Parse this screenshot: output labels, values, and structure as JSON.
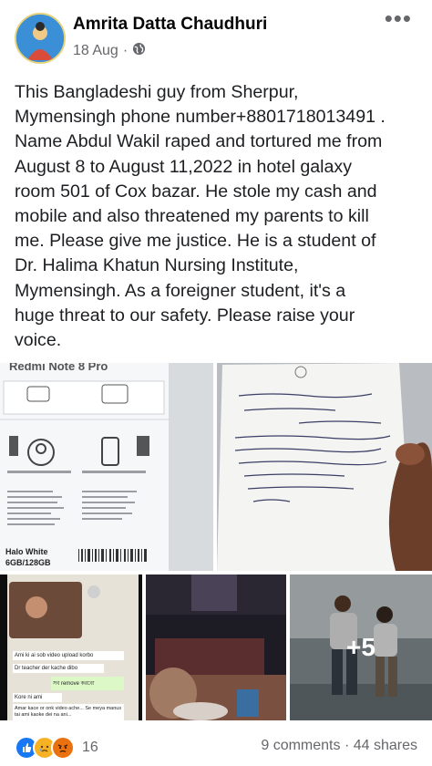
{
  "post": {
    "author": "Amrita Datta Chaudhuri",
    "date": "18 Aug",
    "separator": "·",
    "privacy_icon": "globe-icon",
    "more_icon": "ellipsis-icon",
    "text_lines": [
      "This Bangladeshi guy from Sherpur,",
      "Mymensingh phone number+8801718013491 .",
      "Name Abdul Wakil raped and tortured me from",
      "August 8 to August 11,2022 in hotel galaxy",
      "room 501 of Cox bazar. He stole my cash and",
      "mobile and also threatened my parents to kill",
      "me. Please give me justice. He is a student of",
      "Dr. Halima Khatun Nursing Institute,",
      "Mymensingh. As a foreigner student, it's a",
      "huge threat to our safety. Please raise your",
      "voice."
    ]
  },
  "photos": {
    "box": {
      "brand": "Redmi Note 8 Pro",
      "color": "Halo White",
      "storage": "6GB/128GB"
    },
    "chat": {
      "messages": [
        "Ami ki ai sob video upload korbo",
        "Dr teacher der kache dibo",
        "সব remove করবো",
        "Kore ni ami",
        "Amar kace or onk video ache... Se meya manus tai ami kaoke dei na ani..."
      ]
    },
    "more_count": "+5"
  },
  "footer": {
    "reaction_count": "16",
    "comments": "9 comments",
    "separator": "·",
    "shares": "44 shares"
  },
  "colors": {
    "text": "#1c1e21",
    "secondary": "#65676b",
    "like": "#1877f2",
    "sad": "#f7b125",
    "angry": "#e9710f"
  }
}
